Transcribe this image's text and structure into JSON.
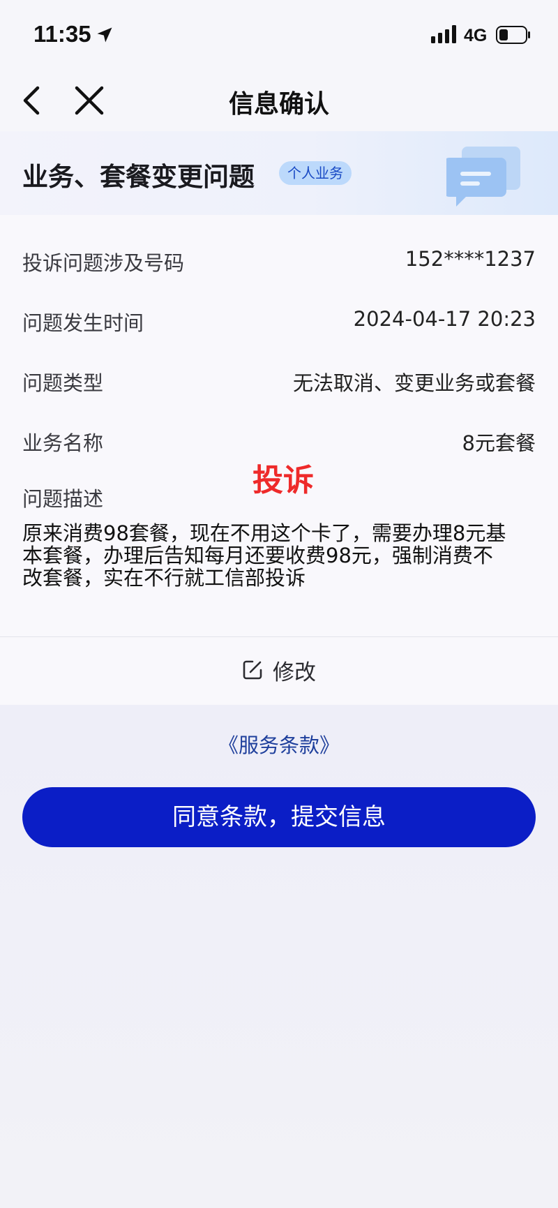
{
  "status_bar": {
    "time": "11:35",
    "network": "4G",
    "icons": [
      "location-arrow-icon",
      "signal-icon",
      "battery-icon"
    ]
  },
  "navbar": {
    "title": "信息确认",
    "icons": [
      "back-chevron-icon",
      "close-icon"
    ]
  },
  "banner": {
    "title": "业务、套餐变更问题",
    "badge": "个人业务",
    "icon": "chat-bubbles-icon"
  },
  "details": {
    "rows": [
      {
        "label": "投诉问题涉及号码",
        "value": "152****1237"
      },
      {
        "label": "问题发生时间",
        "value": "2024-04-17 20:23"
      },
      {
        "label": "问题类型",
        "value": "无法取消、变更业务或套餐"
      },
      {
        "label": "业务名称",
        "value": "8元套餐"
      }
    ],
    "description_label": "问题描述",
    "description_lines": [
      "原来消费98套餐，现在不用这个卡了，需要办理8元基",
      "本套餐，办理后告知每月还要收费98元，强制消费不",
      "改套餐，实在不行就工信部投诉"
    ],
    "overlay_text": "投诉"
  },
  "edit": {
    "label": "修改",
    "icon": "edit-pencil-icon"
  },
  "terms": {
    "label": "《服务条款》"
  },
  "submit": {
    "label": "同意条款，提交信息"
  },
  "colors": {
    "primary_button": "#0b1ec6",
    "link": "#1e3f9c",
    "badge_bg": "#bcd9fb",
    "badge_text": "#1849c4",
    "stamp": "#ee2a2a"
  }
}
